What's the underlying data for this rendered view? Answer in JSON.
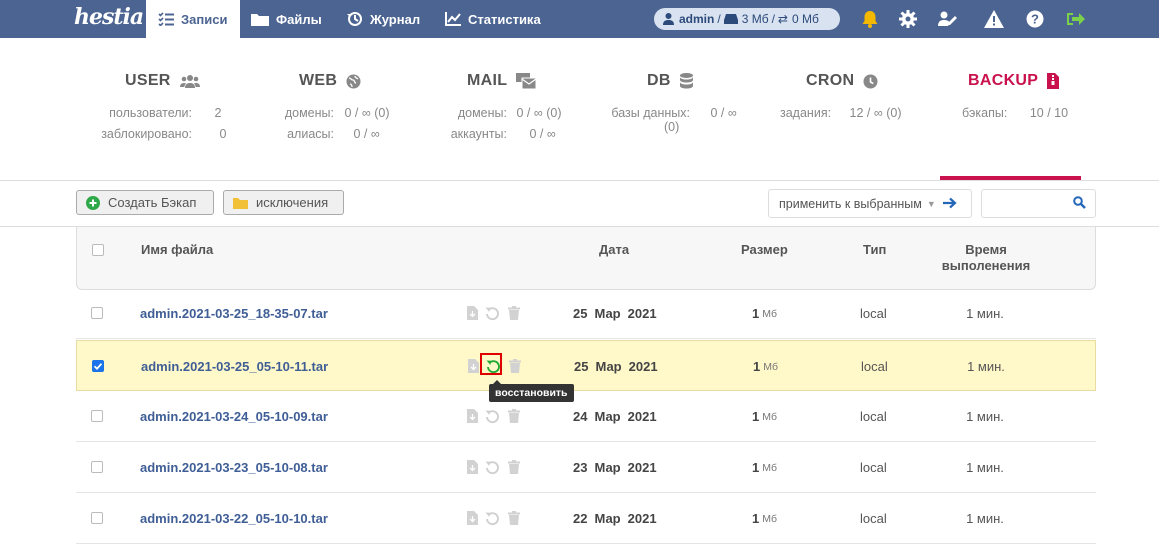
{
  "app": {
    "logo_text": "hestia"
  },
  "nav": [
    {
      "label": "Записи",
      "icon": "list-check-icon",
      "active": true
    },
    {
      "label": "Файлы",
      "icon": "folder-icon"
    },
    {
      "label": "Журнал",
      "icon": "history-icon"
    },
    {
      "label": "Статистика",
      "icon": "chart-icon"
    }
  ],
  "user_pill": {
    "user": "admin",
    "sep": "/",
    "disk": "3 Мб",
    "sep2": "/",
    "traffic": "0 Мб"
  },
  "stats": {
    "user": {
      "title": "USER",
      "rows": [
        {
          "label": "пользователи:",
          "value": "2"
        },
        {
          "label": "заблокировано:",
          "value": "0"
        }
      ]
    },
    "web": {
      "title": "WEB",
      "rows": [
        {
          "label": "домены:",
          "value": "0 / ∞ (0)"
        },
        {
          "label": "алиасы:",
          "value": "0 / ∞"
        }
      ]
    },
    "mail": {
      "title": "MAIL",
      "rows": [
        {
          "label": "домены:",
          "value": "0 / ∞ (0)"
        },
        {
          "label": "аккаунты:",
          "value": "0 / ∞"
        }
      ]
    },
    "db": {
      "title": "DB",
      "rows": [
        {
          "label": "базы данных:",
          "value": "0 / ∞"
        },
        {
          "label": "",
          "value": "(0)"
        }
      ]
    },
    "cron": {
      "title": "CRON",
      "rows": [
        {
          "label": "задания:",
          "value": "12 / ∞ (0)"
        }
      ]
    },
    "backup": {
      "title": "BACKUP",
      "rows": [
        {
          "label": "бэкапы:",
          "value": "10 / 10"
        }
      ]
    }
  },
  "toolbar": {
    "create_backup": "Создать Бэкап",
    "exclusions": "исключения",
    "apply_select": "применить к выбранным",
    "search_placeholder": ""
  },
  "table": {
    "headers": {
      "filename": "Имя файла",
      "date": "Дата",
      "size": "Размер",
      "type": "Тип",
      "runtime_1": "Время",
      "runtime_2": "выполенения"
    },
    "rows": [
      {
        "filename": "admin.2021-03-25_18-35-07.tar",
        "day": "25",
        "month": "Мар",
        "year": "2021",
        "size": "1",
        "unit": "Мб",
        "type": "local",
        "runtime": "1 мин.",
        "checked": false
      },
      {
        "filename": "admin.2021-03-25_05-10-11.tar",
        "day": "25",
        "month": "Мар",
        "year": "2021",
        "size": "1",
        "unit": "Мб",
        "type": "local",
        "runtime": "1 мин.",
        "checked": true
      },
      {
        "filename": "admin.2021-03-24_05-10-09.tar",
        "day": "24",
        "month": "Мар",
        "year": "2021",
        "size": "1",
        "unit": "Мб",
        "type": "local",
        "runtime": "1 мин.",
        "checked": false
      },
      {
        "filename": "admin.2021-03-23_05-10-08.tar",
        "day": "23",
        "month": "Мар",
        "year": "2021",
        "size": "1",
        "unit": "Мб",
        "type": "local",
        "runtime": "1 мин.",
        "checked": false
      },
      {
        "filename": "admin.2021-03-22_05-10-10.tar",
        "day": "22",
        "month": "Мар",
        "year": "2021",
        "size": "1",
        "unit": "Мб",
        "type": "local",
        "runtime": "1 мин.",
        "checked": false
      }
    ]
  },
  "tooltip": {
    "text": "восстановить"
  },
  "colors": {
    "topbar": "#4b6491",
    "accent_backup": "#c9124d",
    "selected_row": "#fff8c9",
    "restore_green": "#22aa33",
    "highlight": "#e00000"
  }
}
